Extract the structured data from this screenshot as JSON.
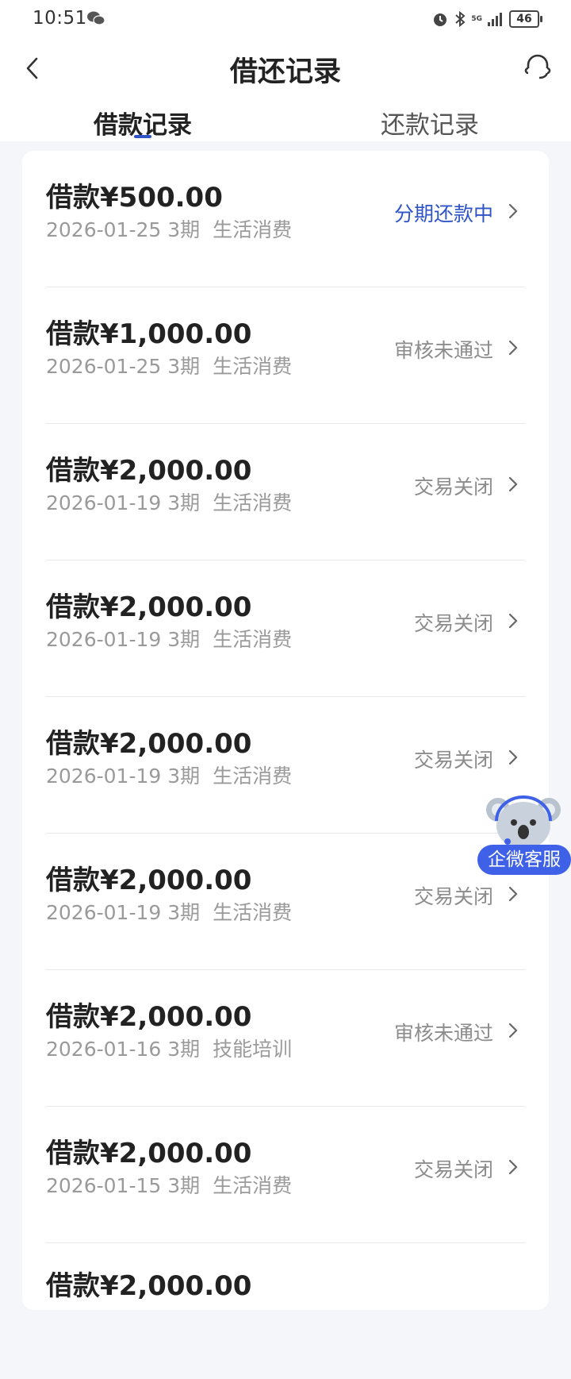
{
  "status_bar": {
    "time": "10:51",
    "signal_label": "5G",
    "battery": "46"
  },
  "header": {
    "title": "借还记录"
  },
  "tabs": [
    {
      "label": "借款记录",
      "active": true
    },
    {
      "label": "还款记录",
      "active": false
    }
  ],
  "records": [
    {
      "amount": "借款¥500.00",
      "date": "2026-01-25",
      "periods": "3期",
      "purpose": "生活消费",
      "status": "分期还款中",
      "status_active": true
    },
    {
      "amount": "借款¥1,000.00",
      "date": "2026-01-25",
      "periods": "3期",
      "purpose": "生活消费",
      "status": "审核未通过"
    },
    {
      "amount": "借款¥2,000.00",
      "date": "2026-01-19",
      "periods": "3期",
      "purpose": "生活消费",
      "status": "交易关闭"
    },
    {
      "amount": "借款¥2,000.00",
      "date": "2026-01-19",
      "periods": "3期",
      "purpose": "生活消费",
      "status": "交易关闭"
    },
    {
      "amount": "借款¥2,000.00",
      "date": "2026-01-19",
      "periods": "3期",
      "purpose": "生活消费",
      "status": "交易关闭"
    },
    {
      "amount": "借款¥2,000.00",
      "date": "2026-01-19",
      "periods": "3期",
      "purpose": "生活消费",
      "status": "交易关闭"
    },
    {
      "amount": "借款¥2,000.00",
      "date": "2026-01-16",
      "periods": "3期",
      "purpose": "技能培训",
      "status": "审核未通过"
    },
    {
      "amount": "借款¥2,000.00",
      "date": "2026-01-15",
      "periods": "3期",
      "purpose": "生活消费",
      "status": "交易关闭"
    },
    {
      "amount": "借款¥2,000.00",
      "date": "",
      "periods": "",
      "purpose": "",
      "status": ""
    }
  ],
  "floating_service": {
    "label": "企微客服"
  },
  "colors": {
    "accent": "#2f54c8",
    "kefu": "#3f61e8",
    "muted": "#9a9a9a"
  }
}
